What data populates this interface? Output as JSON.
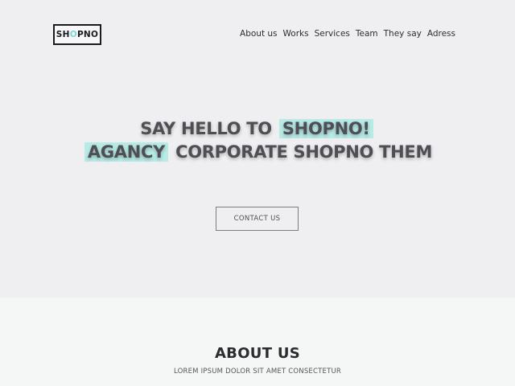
{
  "brand": {
    "logo_prefix": "SH",
    "logo_accent": "O",
    "logo_suffix": "PNO"
  },
  "nav": {
    "items": [
      "About us",
      "Works",
      "Services",
      "Team",
      "They say",
      "Adress"
    ]
  },
  "hero": {
    "line1_text": "SAY HELLO TO",
    "line1_highlight": "SHOPNO!",
    "line2_highlight": "AGANCY",
    "line2_text": "CORPORATE SHOPNO THEM",
    "contact_label": "CONTACT US"
  },
  "about": {
    "title": "ABOUT US",
    "subtitle": "LOREM IPSUM DOLOR SIT AMET CONSECTETUR"
  },
  "colors": {
    "accent": "#b8ebe6",
    "logo_accent": "#7fd7d3",
    "hero_bg": "#efeff1",
    "about_bg": "#f5f7f6"
  }
}
